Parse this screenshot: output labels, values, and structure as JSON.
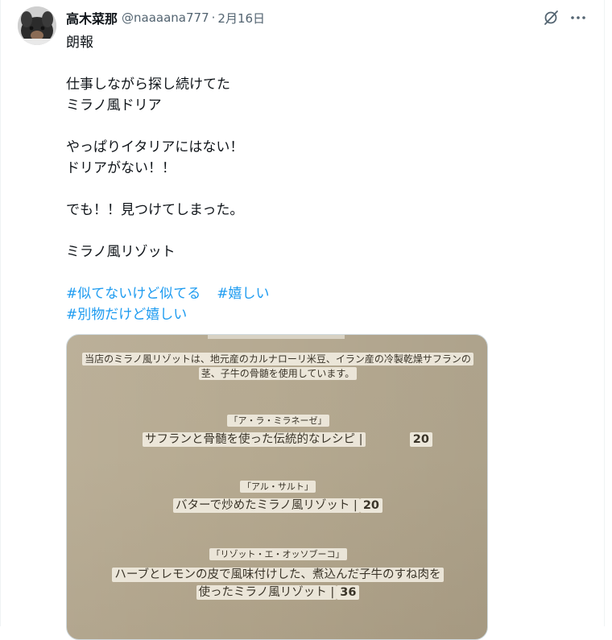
{
  "tweet": {
    "author": {
      "display_name": "高木菜那",
      "handle": "@naaaana777",
      "separator": "·",
      "date": "2月16日"
    },
    "header_icons": [
      "grok-icon",
      "more-icon"
    ],
    "body": {
      "p1": "朗報",
      "p2": "仕事しながら探し続けてた\nミラノ風ドリア",
      "p3": "やっぱりイタリアにはない！\nドリアがない！！",
      "p4": "でも！！見つけてしまった。",
      "p5": "ミラノ風リゾット"
    },
    "hashtags": [
      "#似てないけど似てる",
      "#嬉しい",
      "#別物だけど嬉しい"
    ]
  },
  "media": {
    "intro_line1": "当店のミラノ風リゾットは、地元産のカルナローリ米豆、イラン産の冷製乾燥サフランの",
    "intro_line2": "茎、子牛の骨髄を使用しています。",
    "items": [
      {
        "name": "「ア・ラ・ミラネーゼ」",
        "desc": "サフランと骨髄を使った伝統的なレシピ |",
        "price": "20"
      },
      {
        "name": "「アル・サルト」",
        "desc": "バターで炒めたミラノ風リゾット |",
        "price": "20"
      },
      {
        "name": "「リゾット・エ・オッソブーコ」",
        "desc_line1": "ハーブとレモンの皮で風味付けした、煮込んだ子牛のすね肉を",
        "desc": "使ったミラノ風リゾット |",
        "price": "36"
      }
    ]
  }
}
